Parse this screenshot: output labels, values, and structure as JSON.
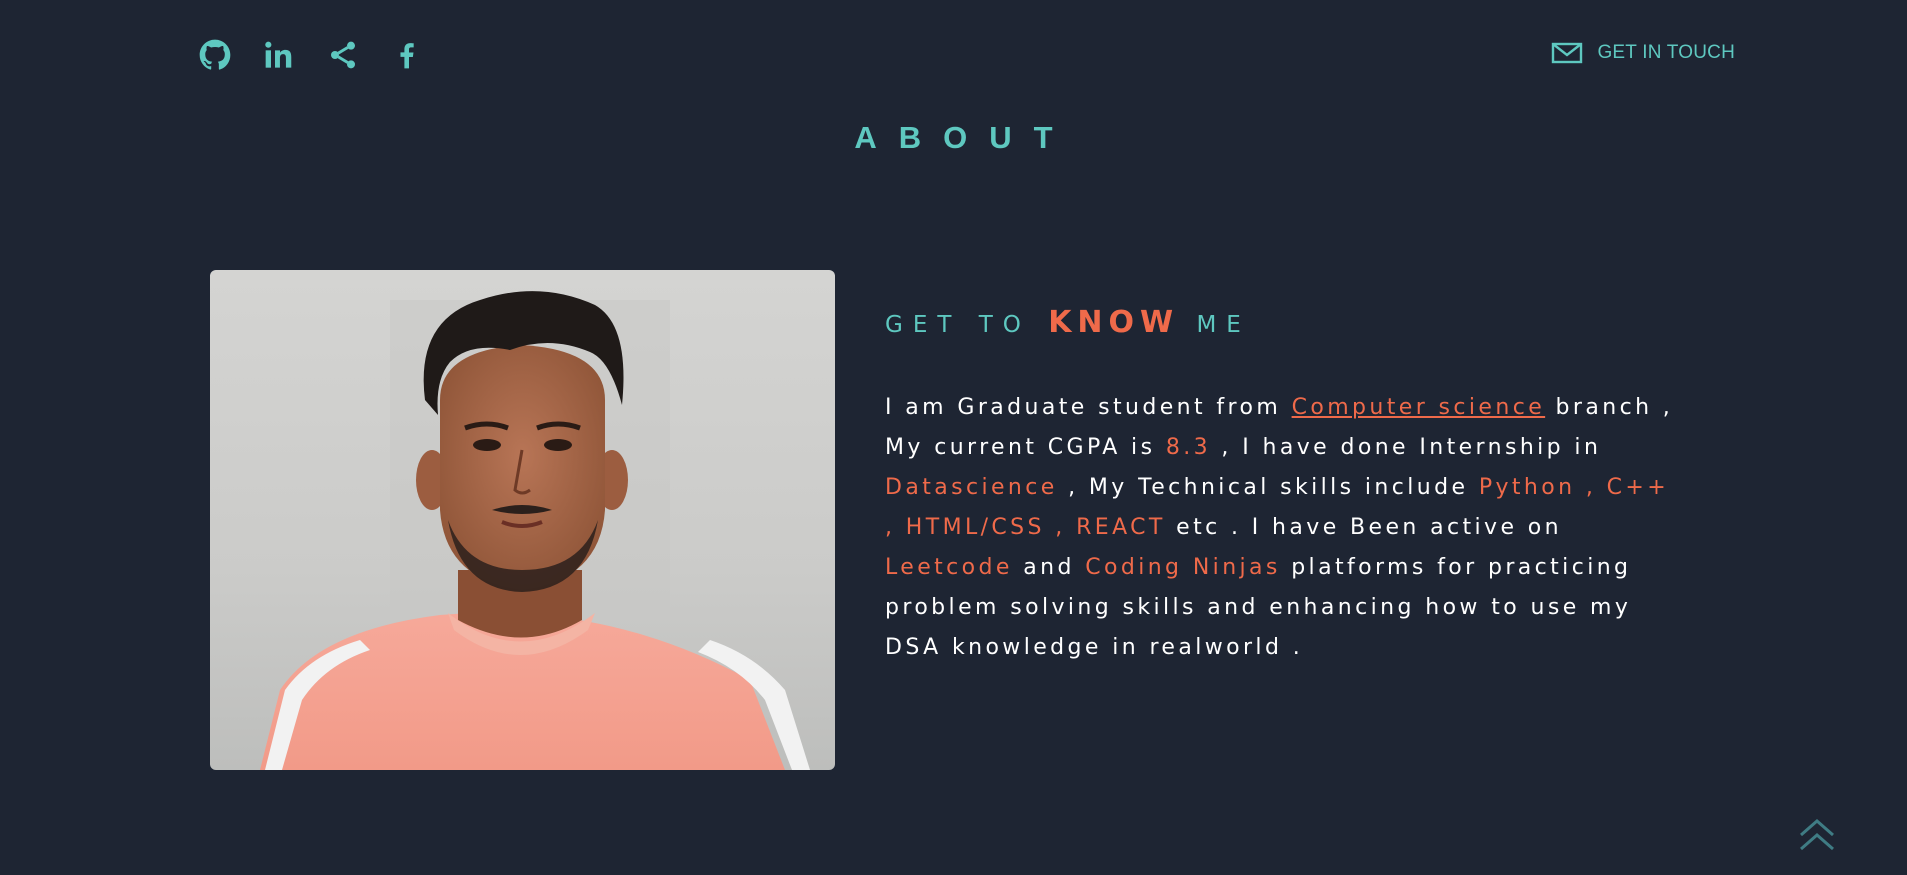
{
  "header": {
    "social_icons": [
      "github-icon",
      "linkedin-icon",
      "share-icon",
      "facebook-icon"
    ],
    "contact_label": "GET IN TOUCH",
    "contact_icon": "mail-icon"
  },
  "section": {
    "title": "ABOUT"
  },
  "about": {
    "heading_pre": "GET TO",
    "heading_accent": "KNOW",
    "heading_post": "ME",
    "bio": {
      "p1": "I am Graduate student from ",
      "branch_link": "Computer science",
      "p2": " branch , My current CGPA is ",
      "cgpa": "8.3",
      "p3": " , I have done Internship in ",
      "internship": "Datascience",
      "p4": " , My Technical skills include ",
      "skills": "Python , C++ , HTML/CSS , REACT",
      "p5": " etc . I have Been active on ",
      "platform1": "Leetcode",
      "p6": " and ",
      "platform2": "Coding Ninjas",
      "p7": " platforms for practicing problem solving skills and enhancing how to use my DSA knowledge in realworld ."
    }
  },
  "colors": {
    "background": "#1e2533",
    "teal": "#5ec8c0",
    "accent": "#ef6a4a",
    "text": "#ffffff"
  },
  "scroll_top_icon": "chevron-double-up-icon"
}
